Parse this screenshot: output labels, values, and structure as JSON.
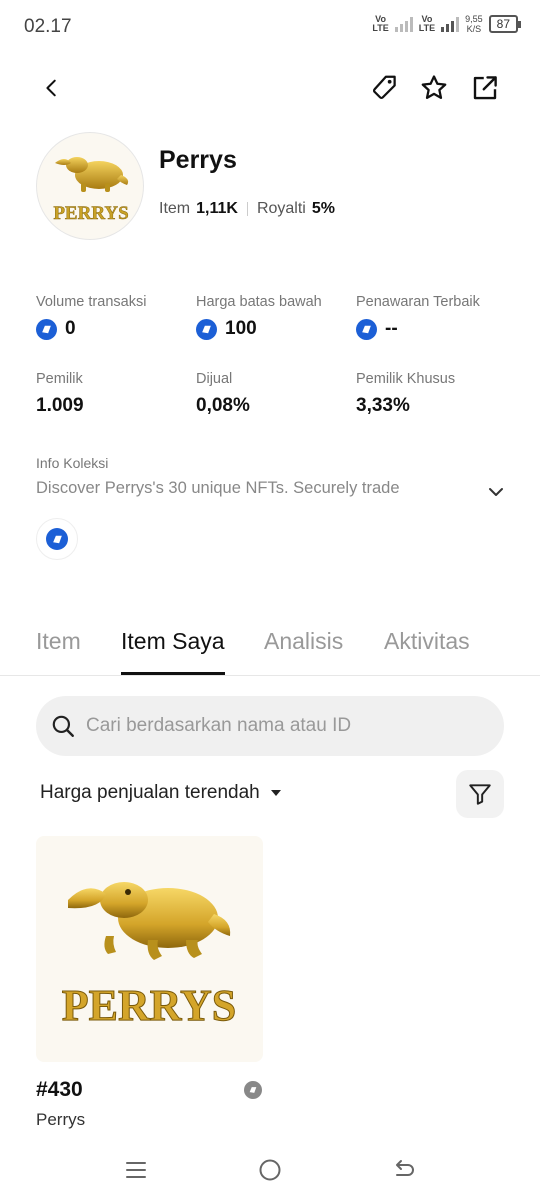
{
  "status": {
    "time": "02.17",
    "net1": "Vo\nLTE",
    "net2": "Vo\nLTE",
    "speed_value": "9,55",
    "speed_unit": "K/S",
    "battery": "87"
  },
  "header": {
    "back_icon": "back-arrow-icon",
    "tag_icon": "price-tag-icon",
    "star_icon": "star-icon",
    "share_icon": "share-external-icon"
  },
  "collection": {
    "name": "Perrys",
    "item_label": "Item",
    "item_value": "1,11K",
    "royalty_label": "Royalti",
    "royalty_value": "5%",
    "logo_text": "PERRYS"
  },
  "stats": [
    {
      "label": "Volume transaksi",
      "value": "0",
      "coin": true
    },
    {
      "label": "Harga batas bawah",
      "value": "100",
      "coin": true
    },
    {
      "label": "Penawaran Terbaik",
      "value": "--",
      "coin": true
    },
    {
      "label": "Pemilik",
      "value": "1.009",
      "coin": false
    },
    {
      "label": "Dijual",
      "value": "0,08%",
      "coin": false
    },
    {
      "label": "Pemilik Khusus",
      "value": "3,33%",
      "coin": false
    }
  ],
  "info": {
    "label": "Info Koleksi",
    "text": "Discover Perrys's 30 unique NFTs. Securely trade"
  },
  "tabs": [
    {
      "label": "Item",
      "active": false
    },
    {
      "label": "Item Saya",
      "active": true
    },
    {
      "label": "Analisis",
      "active": false
    },
    {
      "label": "Aktivitas",
      "active": false
    }
  ],
  "search": {
    "placeholder": "Cari berdasarkan nama atau ID"
  },
  "sort": {
    "label": "Harga penjualan terendah"
  },
  "items": [
    {
      "id": "#430",
      "collection": "Perrys",
      "image_text": "PERRYS"
    }
  ],
  "colors": {
    "accent_blue": "#1c5fd6",
    "gold": "#c9a227",
    "text_primary": "#111111",
    "text_secondary": "#777777"
  }
}
